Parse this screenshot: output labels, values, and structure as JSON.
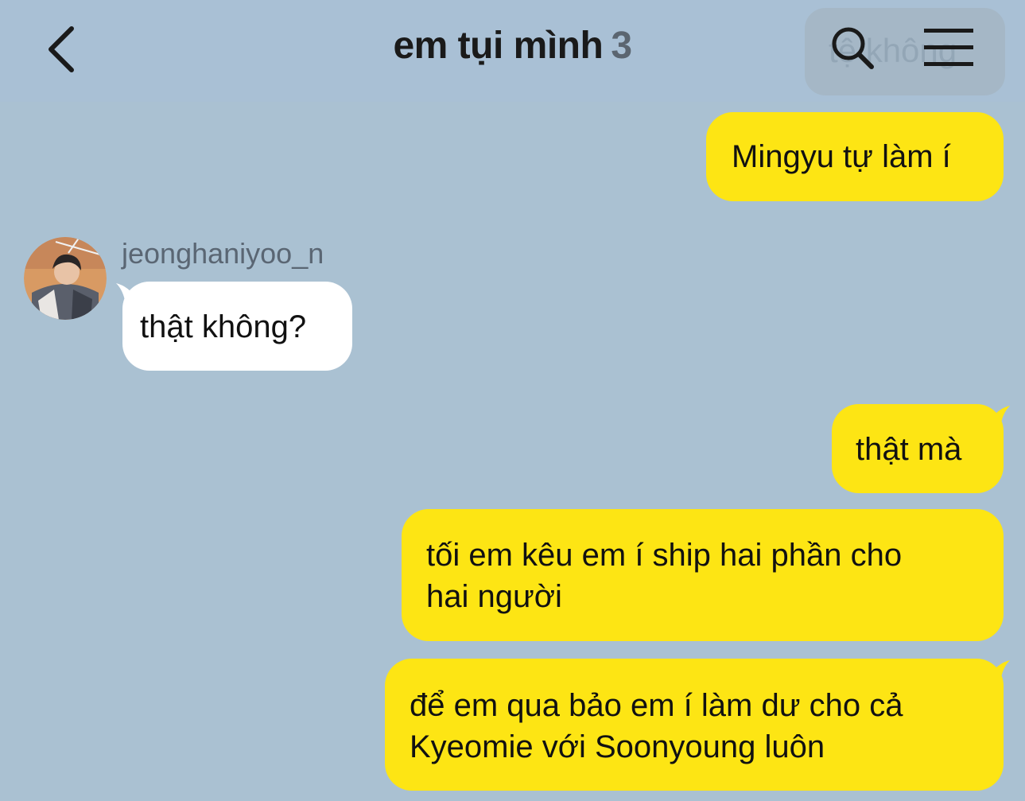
{
  "header": {
    "title": "em tụi mình",
    "member_count": "3",
    "search_ghost_text": "tệ không",
    "back_icon": "chevron-left-icon",
    "search_icon": "search-icon",
    "menu_icon": "hamburger-menu-icon"
  },
  "colors": {
    "background": "#aac1d2",
    "my_bubble": "#fde514",
    "other_bubble": "#ffffff",
    "sender_name": "#5a6673"
  },
  "messages": [
    {
      "sender": "me",
      "lines": [
        "Mingyu tự làm í"
      ]
    },
    {
      "sender": "jeonghaniyoo_n",
      "lines": [
        "thật không?"
      ]
    },
    {
      "sender": "me",
      "lines": [
        "thật mà"
      ]
    },
    {
      "sender": "me",
      "lines": [
        "tối em kêu em í ship hai phần cho",
        "hai người"
      ]
    },
    {
      "sender": "me",
      "lines": [
        "để em qua bảo em í làm dư cho cả",
        "Kyeomie với Soonyoung luôn"
      ]
    }
  ],
  "participants": {
    "other_name": "jeonghaniyoo_n"
  }
}
